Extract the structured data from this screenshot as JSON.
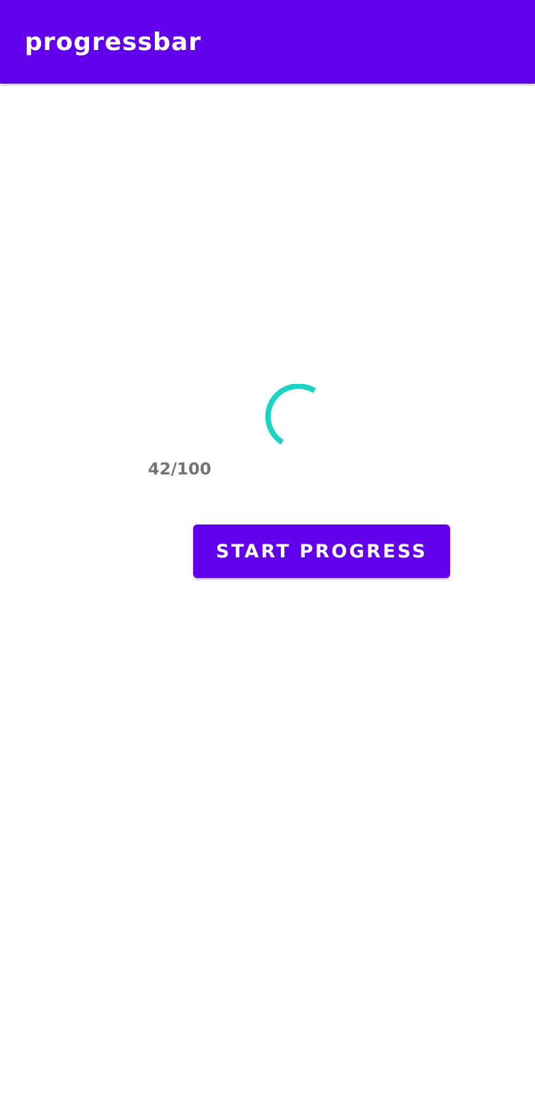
{
  "app_bar": {
    "title": "progressbar",
    "color": "#6200EE"
  },
  "progress": {
    "text": "42/100",
    "value": 42,
    "max": 100,
    "indicator_color": "#1DD3C2"
  },
  "actions": {
    "start_label": "START PROGRESS"
  }
}
